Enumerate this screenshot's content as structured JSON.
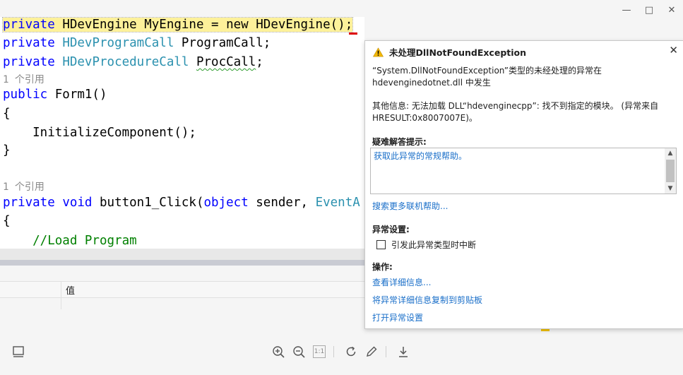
{
  "window": {
    "minimize_icon": "minimize-icon",
    "maximize_icon": "maximize-icon",
    "close_icon": "close-icon"
  },
  "editor": {
    "line1": {
      "kw": "private",
      "type": "HDevEngine",
      "rest": " MyEngine = ",
      "new": "new",
      "type2": "HDevEngine",
      "end": "();"
    },
    "line2": {
      "kw": "private",
      "type": "HDevProgramCall",
      "rest": " ProgramCall;"
    },
    "line3": {
      "kw": "private",
      "type": "HDevProcedureCall",
      "name": "ProcCall",
      "end": ";"
    },
    "codelens1": "1 个引用",
    "line4": {
      "kw": "public",
      "rest": " Form1()"
    },
    "line5": "{",
    "line6": "    InitializeComponent();",
    "line7": "}",
    "codelens2": "1 个引用",
    "line8": {
      "kw": "private",
      "kw2": "void",
      "rest": " button1_Click(",
      "kw3": "object",
      "rest2": " sender, ",
      "type": "EventA"
    },
    "line9": "{",
    "line10": "    //Load Program"
  },
  "grid": {
    "value_header": "值"
  },
  "popup": {
    "title": "未处理DllNotFoundException",
    "message": "“System.DllNotFoundException”类型的未经处理的异常在 hdevenginedotnet.dll 中发生",
    "info": "其他信息: 无法加载 DLL“hdevenginecpp”: 找不到指定的模块。 (异常来自 HRESULT:0x8007007E)。",
    "troubleshoot_label": "疑难解答提示:",
    "help_link": "获取此异常的常规帮助。",
    "online_link": "搜索更多联机帮助...",
    "settings_label": "异常设置:",
    "break_checkbox": "引发此异常类型时中断",
    "break_checked": false,
    "actions_label": "操作:",
    "action_details": "查看详细信息...",
    "action_copy": "将异常详细信息复制到剪贴板",
    "action_open": "打开异常设置",
    "warning_color": "#f2b705",
    "link_color": "#1a6fc9"
  },
  "toolbar": {
    "icons": [
      "panel-icon",
      "zoom-in-icon",
      "zoom-out-icon",
      "actual-size-icon",
      "refresh-icon",
      "pen-icon",
      "download-icon"
    ],
    "actual_size_label": "1:1"
  }
}
